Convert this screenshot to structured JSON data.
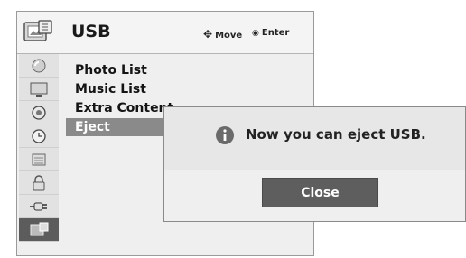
{
  "header": {
    "title": "USB",
    "move_label": "Move",
    "enter_label": "Enter",
    "icon": "usb-menu-icon"
  },
  "sidebar": {
    "items": [
      {
        "icon": "picture-icon"
      },
      {
        "icon": "screen-icon"
      },
      {
        "icon": "audio-icon"
      },
      {
        "icon": "clock-icon"
      },
      {
        "icon": "option-icon"
      },
      {
        "icon": "lock-icon"
      },
      {
        "icon": "input-plug-icon"
      },
      {
        "icon": "usb-icon",
        "active": true
      }
    ]
  },
  "list": {
    "items": [
      {
        "label": "Photo List"
      },
      {
        "label": "Music List"
      },
      {
        "label": "Extra Content"
      },
      {
        "label": "Eject",
        "selected": true
      }
    ]
  },
  "dialog": {
    "message": "Now you can eject USB.",
    "close_label": "Close",
    "icon": "info-icon"
  }
}
